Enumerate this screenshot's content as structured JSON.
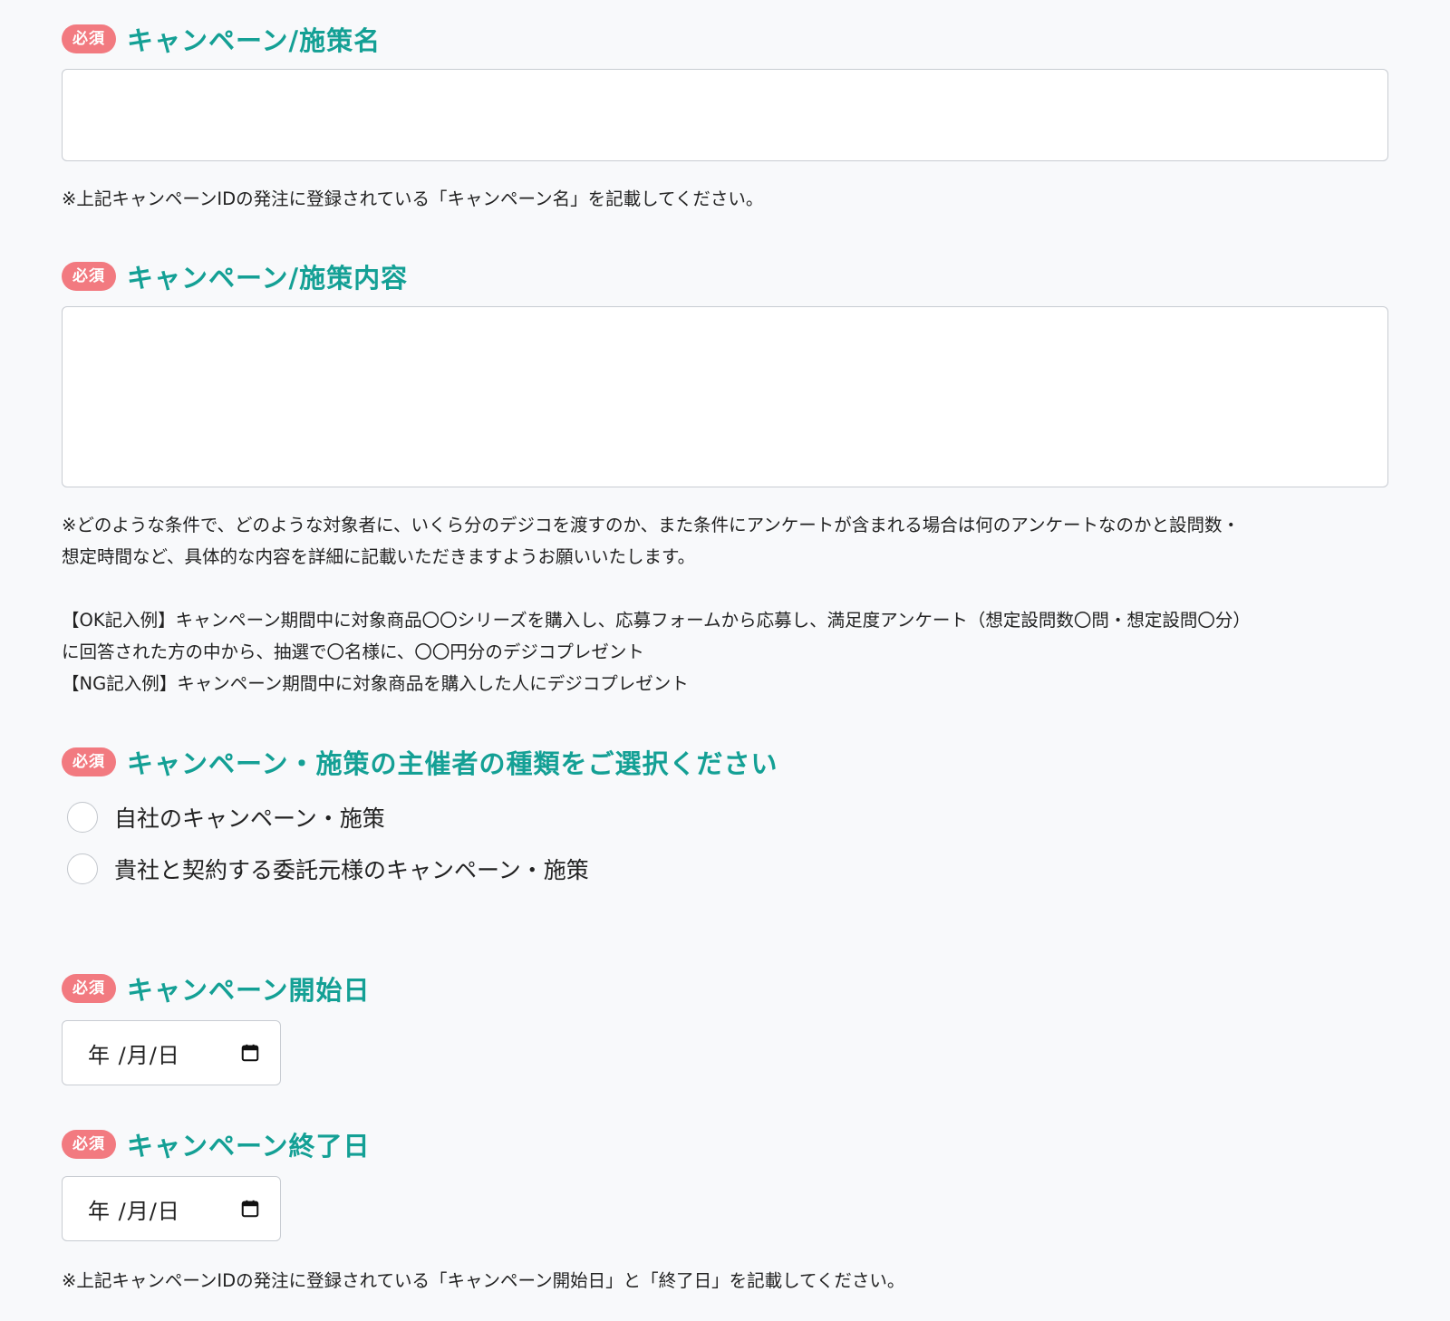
{
  "required_badge": "必須",
  "fields": {
    "campaign_name": {
      "label": "キャンペーン/施策名",
      "value": "",
      "note": "※上記キャンペーンIDの発注に登録されている「キャンペーン名」を記載してください。"
    },
    "campaign_content": {
      "label": "キャンペーン/施策内容",
      "value": "",
      "note_line1": "※どのような条件で、どのような対象者に、いくら分のデジコを渡すのか、また条件にアンケートが含まれる場合は何のアンケートなのかと設問数・",
      "note_line2": "想定時間など、具体的な内容を詳細に記載いただきますようお願いいたします。",
      "ok_example_line1": "【OK記入例】キャンペーン期間中に対象商品〇〇シリーズを購入し、応募フォームから応募し、満足度アンケート（想定設問数〇問・想定設問〇分）",
      "ok_example_line2": "に回答された方の中から、抽選で〇名様に、〇〇円分のデジコプレゼント",
      "ng_example": "【NG記入例】キャンペーン期間中に対象商品を購入した人にデジコプレゼント"
    },
    "organizer_type": {
      "label": "キャンペーン・施策の主催者の種類をご選択ください",
      "options": [
        "自社のキャンペーン・施策",
        "貴社と契約する委託元様のキャンペーン・施策"
      ]
    },
    "start_date": {
      "label": "キャンペーン開始日",
      "placeholder": "年 /月/日"
    },
    "end_date": {
      "label": "キャンペーン終了日",
      "placeholder": "年 /月/日",
      "note": "※上記キャンペーンIDの発注に登録されている「キャンペーン開始日」と「終了日」を記載してください。"
    }
  },
  "icons": {
    "calendar": "calendar-icon"
  },
  "colors": {
    "accent": "#14a095",
    "required_badge": "#f27a80",
    "background": "#f8f9fb"
  }
}
